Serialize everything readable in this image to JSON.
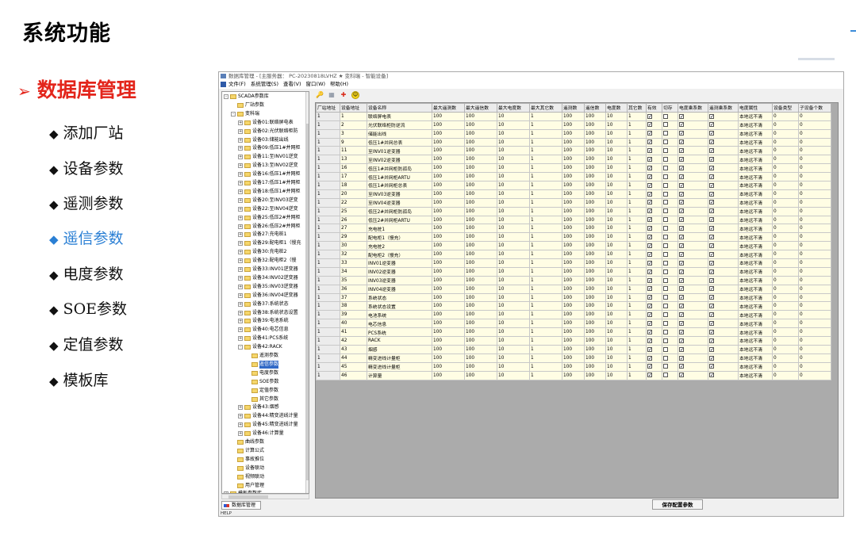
{
  "slide": {
    "title": "系统功能",
    "section": "数据库管理",
    "bullets": [
      {
        "label": "添加厂站",
        "active": false
      },
      {
        "label": "设备参数",
        "active": false
      },
      {
        "label": "遥测参数",
        "active": false
      },
      {
        "label": "遥信参数",
        "active": true
      },
      {
        "label": "电度参数",
        "active": false
      },
      {
        "label": "SOE参数",
        "active": false
      },
      {
        "label": "定值参数",
        "active": false
      },
      {
        "label": "模板库",
        "active": false
      }
    ]
  },
  "app": {
    "titlebar": "数据库管理 - [主服务器： PC-20230818LVHZ ★ 变科瑞 - 智能设备]",
    "menu": [
      "文件(F)",
      "系统管理(S)",
      "查看(V)",
      "窗口(W)",
      "帮助(H)"
    ],
    "toolbar_icons": [
      "key-icon",
      "print-icon",
      "run-icon",
      "smile-icon"
    ],
    "status": "HELP",
    "tab_label": "数据库管理",
    "save_button": "保存配置参数"
  },
  "tree": [
    {
      "label": "SCADA参数库",
      "lvl": 0,
      "exp": "-"
    },
    {
      "label": "厂站参数",
      "lvl": 1,
      "exp": ""
    },
    {
      "label": "变科瑞",
      "lvl": 1,
      "exp": "-"
    },
    {
      "label": "设备01:联络屏电表",
      "lvl": 2,
      "exp": "+"
    },
    {
      "label": "设备02:光伏联络柜防",
      "lvl": 2,
      "exp": "+"
    },
    {
      "label": "设备03:储能出线",
      "lvl": 2,
      "exp": "+"
    },
    {
      "label": "设备09:低压1#并网柜",
      "lvl": 2,
      "exp": "+"
    },
    {
      "label": "设备11:至INV01逆变",
      "lvl": 2,
      "exp": "+"
    },
    {
      "label": "设备13:至INV02逆变",
      "lvl": 2,
      "exp": "+"
    },
    {
      "label": "设备16:低压1#并网柜",
      "lvl": 2,
      "exp": "+"
    },
    {
      "label": "设备17:低压1#并网柜",
      "lvl": 2,
      "exp": "+"
    },
    {
      "label": "设备18:低压1#并网柜",
      "lvl": 2,
      "exp": "+"
    },
    {
      "label": "设备20:至INV03逆变",
      "lvl": 2,
      "exp": "+"
    },
    {
      "label": "设备22:至INV04逆变",
      "lvl": 2,
      "exp": "+"
    },
    {
      "label": "设备25:低压2#并网柜",
      "lvl": 2,
      "exp": "+"
    },
    {
      "label": "设备26:低压2#并网柜",
      "lvl": 2,
      "exp": "+"
    },
    {
      "label": "设备27:充电桩1",
      "lvl": 2,
      "exp": "+"
    },
    {
      "label": "设备29:配电柜1（慢充",
      "lvl": 2,
      "exp": "+"
    },
    {
      "label": "设备30:充电桩2",
      "lvl": 2,
      "exp": "+"
    },
    {
      "label": "设备32:配电柜2（慢",
      "lvl": 2,
      "exp": "+"
    },
    {
      "label": "设备33:INV01逆变器",
      "lvl": 2,
      "exp": "+"
    },
    {
      "label": "设备34:INV02逆变器",
      "lvl": 2,
      "exp": "+"
    },
    {
      "label": "设备35:INV03逆变器",
      "lvl": 2,
      "exp": "+"
    },
    {
      "label": "设备36:INV04逆变器",
      "lvl": 2,
      "exp": "+"
    },
    {
      "label": "设备37:系统状态",
      "lvl": 2,
      "exp": "+"
    },
    {
      "label": "设备38:系统状态设置",
      "lvl": 2,
      "exp": "+"
    },
    {
      "label": "设备39:电池系统",
      "lvl": 2,
      "exp": "+"
    },
    {
      "label": "设备40:电芯信息",
      "lvl": 2,
      "exp": "+"
    },
    {
      "label": "设备41:PCS系统",
      "lvl": 2,
      "exp": "+"
    },
    {
      "label": "设备42:RACK",
      "lvl": 2,
      "exp": "-"
    },
    {
      "label": "遥测参数",
      "lvl": 3,
      "exp": ""
    },
    {
      "label": "遥信参数",
      "lvl": 3,
      "exp": "",
      "selected": true
    },
    {
      "label": "电度参数",
      "lvl": 3,
      "exp": ""
    },
    {
      "label": "SOE参数",
      "lvl": 3,
      "exp": ""
    },
    {
      "label": "定值参数",
      "lvl": 3,
      "exp": ""
    },
    {
      "label": "其它参数",
      "lvl": 3,
      "exp": ""
    },
    {
      "label": "设备43:烟感",
      "lvl": 2,
      "exp": "+"
    },
    {
      "label": "设备44:精变进线计量",
      "lvl": 2,
      "exp": "+"
    },
    {
      "label": "设备45:精变进线计量",
      "lvl": 2,
      "exp": "+"
    },
    {
      "label": "设备46:计算量",
      "lvl": 2,
      "exp": "+"
    },
    {
      "label": "曲线参数",
      "lvl": 1,
      "exp": ""
    },
    {
      "label": "计算公式",
      "lvl": 1,
      "exp": ""
    },
    {
      "label": "事故推位",
      "lvl": 1,
      "exp": ""
    },
    {
      "label": "设备联动",
      "lvl": 1,
      "exp": ""
    },
    {
      "label": "视频联动",
      "lvl": 1,
      "exp": ""
    },
    {
      "label": "用户管理",
      "lvl": 1,
      "exp": ""
    },
    {
      "label": "模板参数库",
      "lvl": 0,
      "exp": "+"
    }
  ],
  "grid": {
    "columns": [
      "厂站地址",
      "设备地址",
      "设备名称",
      "最大遥测数",
      "最大遥信数",
      "最大电度数",
      "最大其它数",
      "遥测数",
      "遥信数",
      "电度数",
      "其它数",
      "有效",
      "切存",
      "电度乘系数",
      "遥测乘系数",
      "电度属性",
      "设备类型",
      "子设备个数"
    ],
    "rows": [
      [
        "1",
        "1",
        "联络屏电表",
        "100",
        "100",
        "10",
        "1",
        "100",
        "100",
        "10",
        "1",
        true,
        false,
        true,
        true,
        "本地远不清",
        "0",
        "0"
      ],
      [
        "1",
        "2",
        "光伏联络柜防逆流",
        "100",
        "100",
        "10",
        "1",
        "100",
        "100",
        "10",
        "1",
        true,
        false,
        true,
        true,
        "本地远不清",
        "0",
        "0"
      ],
      [
        "1",
        "3",
        "储能出线",
        "100",
        "100",
        "10",
        "1",
        "100",
        "100",
        "10",
        "1",
        true,
        false,
        true,
        true,
        "本地远不清",
        "0",
        "0"
      ],
      [
        "1",
        "9",
        "低压1#并网总表",
        "100",
        "100",
        "10",
        "1",
        "100",
        "100",
        "10",
        "1",
        true,
        false,
        true,
        true,
        "本地远不清",
        "0",
        "0"
      ],
      [
        "1",
        "11",
        "至INV01逆变器",
        "100",
        "100",
        "10",
        "1",
        "100",
        "100",
        "10",
        "1",
        true,
        false,
        true,
        true,
        "本地远不清",
        "0",
        "0"
      ],
      [
        "1",
        "13",
        "至INV02逆变器",
        "100",
        "100",
        "10",
        "1",
        "100",
        "100",
        "10",
        "1",
        true,
        false,
        true,
        true,
        "本地远不清",
        "0",
        "0"
      ],
      [
        "1",
        "16",
        "低压1#并网柜防孤岛",
        "100",
        "100",
        "10",
        "1",
        "100",
        "100",
        "10",
        "1",
        true,
        false,
        true,
        true,
        "本地远不清",
        "0",
        "0"
      ],
      [
        "1",
        "17",
        "低压1#并网柜ARTU",
        "100",
        "100",
        "10",
        "1",
        "100",
        "100",
        "10",
        "1",
        true,
        false,
        true,
        true,
        "本地远不清",
        "0",
        "0"
      ],
      [
        "1",
        "18",
        "低压1#并网柜总表",
        "100",
        "100",
        "10",
        "1",
        "100",
        "100",
        "10",
        "1",
        true,
        false,
        true,
        true,
        "本地远不清",
        "0",
        "0"
      ],
      [
        "1",
        "20",
        "至INV03逆变器",
        "100",
        "100",
        "10",
        "1",
        "100",
        "100",
        "10",
        "1",
        true,
        false,
        true,
        true,
        "本地远不清",
        "0",
        "0"
      ],
      [
        "1",
        "22",
        "至INV04逆变器",
        "100",
        "100",
        "10",
        "1",
        "100",
        "100",
        "10",
        "1",
        true,
        false,
        true,
        true,
        "本地远不清",
        "0",
        "0"
      ],
      [
        "1",
        "25",
        "低压2#并网柜防孤岛",
        "100",
        "100",
        "10",
        "1",
        "100",
        "100",
        "10",
        "1",
        true,
        false,
        true,
        true,
        "本地远不清",
        "0",
        "0"
      ],
      [
        "1",
        "26",
        "低压2#并网柜ARTU",
        "100",
        "100",
        "10",
        "1",
        "100",
        "100",
        "10",
        "1",
        true,
        false,
        true,
        true,
        "本地远不清",
        "0",
        "0"
      ],
      [
        "1",
        "27",
        "充电桩1",
        "100",
        "100",
        "10",
        "1",
        "100",
        "100",
        "10",
        "1",
        true,
        false,
        true,
        true,
        "本地远不清",
        "0",
        "0"
      ],
      [
        "1",
        "29",
        "配电柜1（慢充）",
        "100",
        "100",
        "10",
        "1",
        "100",
        "100",
        "10",
        "1",
        true,
        false,
        true,
        true,
        "本地远不清",
        "0",
        "0"
      ],
      [
        "1",
        "30",
        "充电桩2",
        "100",
        "100",
        "10",
        "1",
        "100",
        "100",
        "10",
        "1",
        true,
        false,
        true,
        true,
        "本地远不清",
        "0",
        "0"
      ],
      [
        "1",
        "32",
        "配电柜2（慢充）",
        "100",
        "100",
        "10",
        "1",
        "100",
        "100",
        "10",
        "1",
        true,
        false,
        true,
        true,
        "本地远不清",
        "0",
        "0"
      ],
      [
        "1",
        "33",
        "INV01逆变器",
        "100",
        "100",
        "10",
        "1",
        "100",
        "100",
        "10",
        "1",
        true,
        false,
        true,
        true,
        "本地远不清",
        "0",
        "0"
      ],
      [
        "1",
        "34",
        "INV02逆变器",
        "100",
        "100",
        "10",
        "1",
        "100",
        "100",
        "10",
        "1",
        true,
        false,
        true,
        true,
        "本地远不清",
        "0",
        "0"
      ],
      [
        "1",
        "35",
        "INV03逆变器",
        "100",
        "100",
        "10",
        "1",
        "100",
        "100",
        "10",
        "1",
        true,
        false,
        true,
        true,
        "本地远不清",
        "0",
        "0"
      ],
      [
        "1",
        "36",
        "INV04逆变器",
        "100",
        "100",
        "10",
        "1",
        "100",
        "100",
        "10",
        "1",
        true,
        false,
        true,
        true,
        "本地远不清",
        "0",
        "0"
      ],
      [
        "1",
        "37",
        "系统状态",
        "100",
        "100",
        "10",
        "1",
        "100",
        "100",
        "10",
        "1",
        true,
        false,
        true,
        true,
        "本地远不清",
        "0",
        "0"
      ],
      [
        "1",
        "38",
        "系统状态设置",
        "100",
        "100",
        "10",
        "1",
        "100",
        "100",
        "10",
        "1",
        true,
        false,
        true,
        true,
        "本地远不清",
        "0",
        "0"
      ],
      [
        "1",
        "39",
        "电池系统",
        "100",
        "100",
        "10",
        "1",
        "100",
        "100",
        "10",
        "1",
        true,
        false,
        true,
        true,
        "本地远不清",
        "0",
        "0"
      ],
      [
        "1",
        "40",
        "电芯信息",
        "100",
        "100",
        "10",
        "1",
        "100",
        "100",
        "10",
        "1",
        true,
        false,
        true,
        true,
        "本地远不清",
        "0",
        "0"
      ],
      [
        "1",
        "41",
        "PCS系统",
        "100",
        "100",
        "10",
        "1",
        "100",
        "100",
        "10",
        "1",
        true,
        false,
        true,
        true,
        "本地远不清",
        "0",
        "0"
      ],
      [
        "1",
        "42",
        "RACK",
        "100",
        "100",
        "10",
        "1",
        "100",
        "100",
        "10",
        "1",
        true,
        false,
        true,
        true,
        "本地远不清",
        "0",
        "0"
      ],
      [
        "1",
        "43",
        "烟感",
        "100",
        "100",
        "10",
        "1",
        "100",
        "100",
        "10",
        "1",
        true,
        false,
        true,
        true,
        "本地远不清",
        "0",
        "0"
      ],
      [
        "1",
        "44",
        "精变进线计量柜",
        "100",
        "100",
        "10",
        "1",
        "100",
        "100",
        "10",
        "1",
        true,
        false,
        true,
        true,
        "本地远不清",
        "0",
        "0"
      ],
      [
        "1",
        "45",
        "精变进线计量柜",
        "100",
        "100",
        "10",
        "1",
        "100",
        "100",
        "10",
        "1",
        true,
        false,
        true,
        true,
        "本地远不清",
        "0",
        "0"
      ],
      [
        "1",
        "46",
        "计算量",
        "100",
        "100",
        "10",
        "1",
        "100",
        "100",
        "10",
        "1",
        true,
        false,
        true,
        true,
        "本地远不清",
        "0",
        "0"
      ]
    ]
  },
  "colors": {
    "accent_red": "#e3251b",
    "accent_blue": "#2a7fd4",
    "grid_cell": "#fffde4"
  }
}
